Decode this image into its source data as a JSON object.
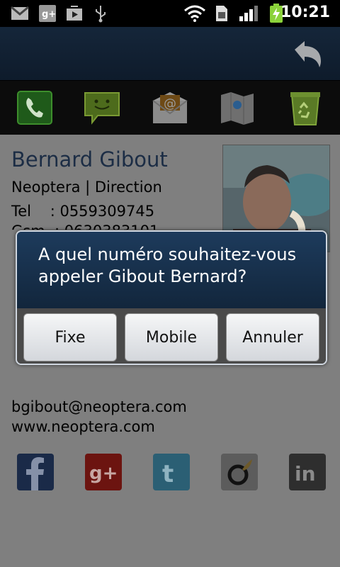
{
  "status_bar": {
    "time": "10:21",
    "icons": [
      "gmail-icon",
      "google-plus-icon",
      "play-store-icon",
      "usb-icon",
      "wifi-icon",
      "sim-icon",
      "signal-icon",
      "battery-charging-icon"
    ]
  },
  "actions": [
    "phone-icon",
    "sms-icon",
    "email-icon",
    "maps-icon",
    "recycle-icon"
  ],
  "contact": {
    "name": "Bernard Gibout",
    "company": "Neoptera | Direction",
    "tel": "Tel    : 0559309745",
    "gsm_partial": "Gsm  : 0630383101",
    "email": "bgibout@neoptera.com",
    "website": "www.neoptera.com"
  },
  "dialog": {
    "title": "A quel numéro souhaitez-vous appeler Gibout Bernard?",
    "buttons": {
      "fixe": "Fixe",
      "mobile": "Mobile",
      "annuler": "Annuler"
    }
  },
  "social": [
    "facebook-icon",
    "google-plus-icon",
    "twitter-icon",
    "viadeo-icon",
    "linkedin-icon"
  ]
}
